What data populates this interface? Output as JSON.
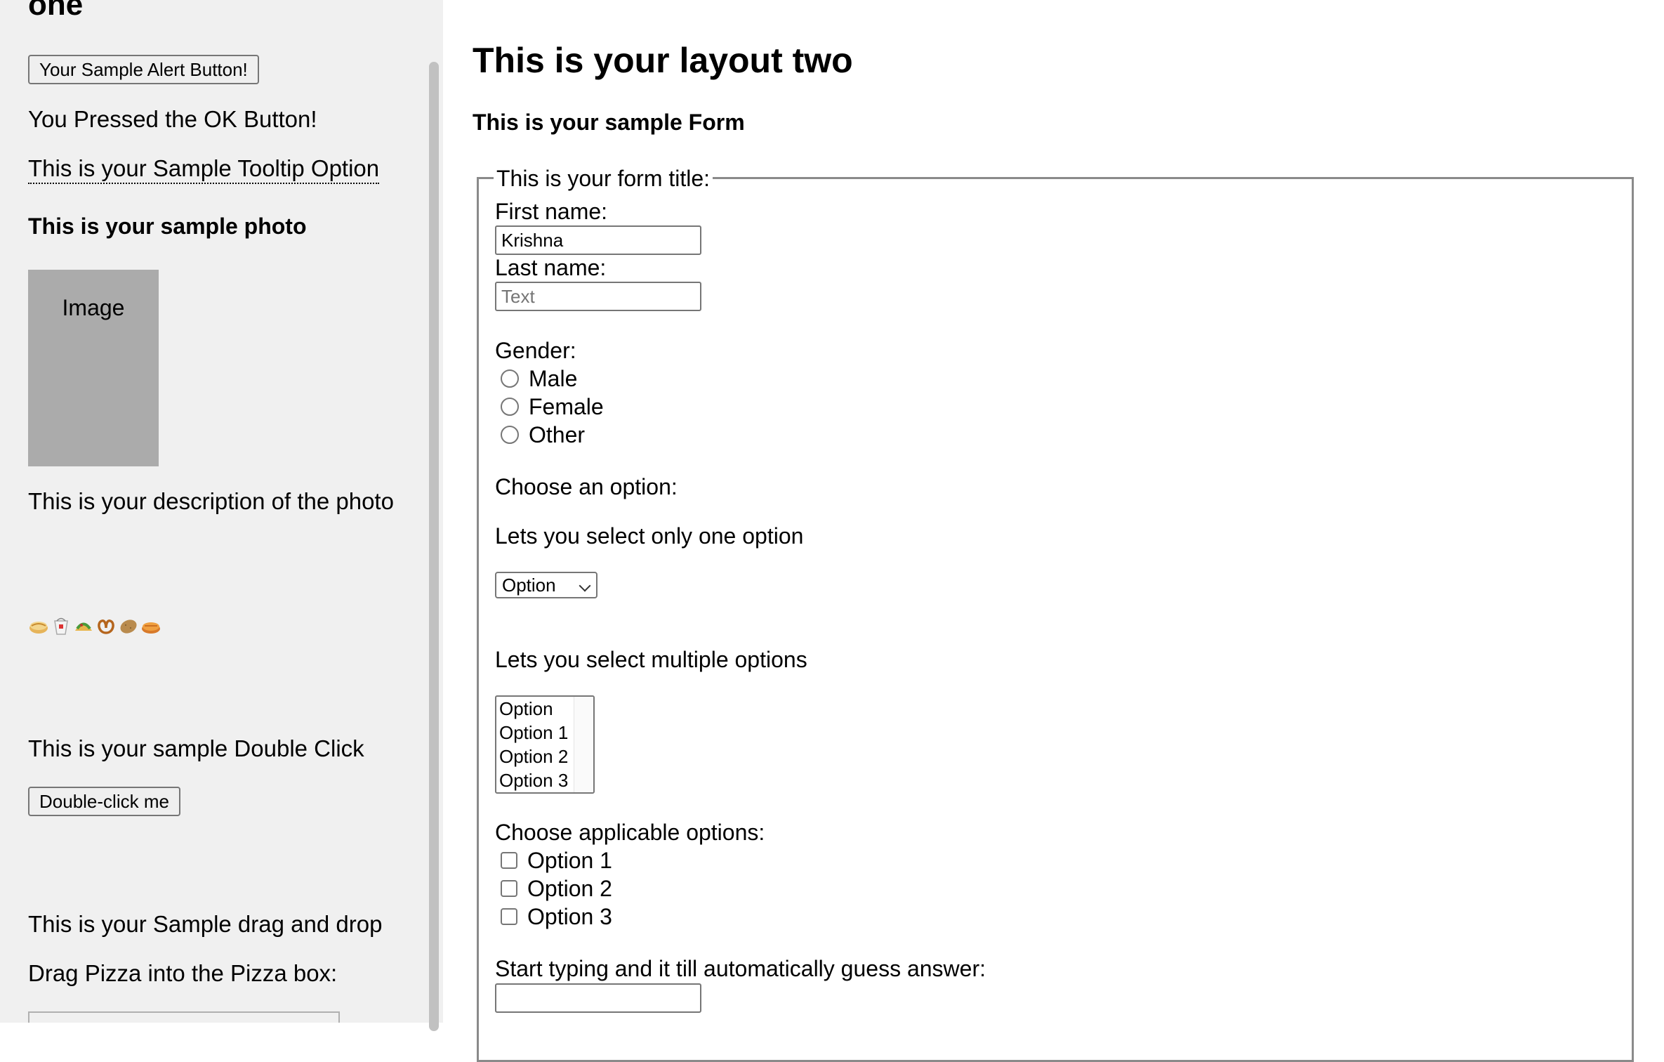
{
  "left": {
    "heading_cut": "one",
    "alert_button": "Your Sample Alert Button!",
    "pressed_text": "You Pressed the OK Button!",
    "tooltip_text": "This is your Sample Tooltip Option",
    "photo_heading": "This is your sample photo",
    "photo_placeholder": "Image",
    "photo_description": "This is your description of the photo",
    "food_icons": [
      "pie-icon",
      "takeout-box-icon",
      "taco-icon",
      "pretzel-icon",
      "potato-icon",
      "pie-icon"
    ],
    "double_click_heading": "This is your sample Double Click",
    "double_click_button": "Double-click me",
    "drag_heading": "This is your Sample drag and drop",
    "drag_instruction": "Drag Pizza into the Pizza box:"
  },
  "right": {
    "title": "This is your layout two",
    "subtitle": "This is your sample Form",
    "form": {
      "legend": "This is your form title:",
      "first_name_label": "First name:",
      "first_name_value": "Krishna",
      "last_name_label": "Last name:",
      "last_name_placeholder": "Text",
      "gender_label": "Gender:",
      "gender_options": [
        "Male",
        "Female",
        "Other"
      ],
      "choose_label": "Choose an option:",
      "single_select_label": "Lets you select only one option",
      "single_select_value": "Option",
      "multi_select_label": "Lets you select multiple options",
      "multi_select_options": [
        "Option",
        "Option 1",
        "Option 2",
        "Option 3"
      ],
      "checkbox_label": "Choose applicable options:",
      "checkbox_options": [
        "Option 1",
        "Option 2",
        "Option 3"
      ],
      "autocomplete_label": "Start typing and it till automatically guess answer:",
      "autocomplete_value": ""
    }
  }
}
